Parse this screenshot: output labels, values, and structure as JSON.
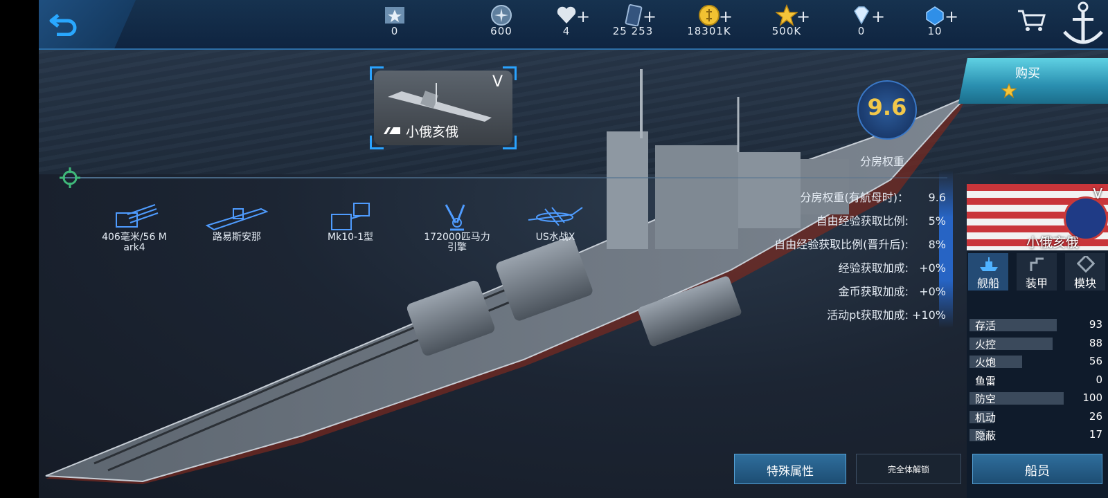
{
  "topbar": {
    "resources": [
      {
        "icon": "rank-badge-icon",
        "value": "0",
        "plus": ""
      },
      {
        "icon": "navy-emblem-icon",
        "value": "600",
        "plus": ""
      },
      {
        "icon": "heart-icon",
        "value": "4",
        "plus": "+"
      },
      {
        "icon": "card-icon",
        "value": "25 253",
        "plus": "+"
      },
      {
        "icon": "gold-coin-icon",
        "value": "18301K",
        "plus": "+"
      },
      {
        "icon": "star-icon",
        "value": "500K",
        "plus": "+"
      },
      {
        "icon": "diamond-icon",
        "value": "0",
        "plus": "+"
      },
      {
        "icon": "blue-gem-icon",
        "value": "10",
        "plus": "+"
      }
    ]
  },
  "ship_card": {
    "tier": "V",
    "name": "小俄亥俄"
  },
  "rating": {
    "value": "9.6",
    "label": "分房权重"
  },
  "buy": {
    "label": "购买"
  },
  "equipment": [
    {
      "icon": "main-gun-icon",
      "label_line1": "406毫米/56 M",
      "label_line2": "ark4"
    },
    {
      "icon": "hull-icon",
      "label_line1": "路易斯安那",
      "label_line2": ""
    },
    {
      "icon": "fire-control-icon",
      "label_line1": "Mk10-1型",
      "label_line2": ""
    },
    {
      "icon": "engine-icon",
      "label_line1": "172000匹马力",
      "label_line2": "引擎"
    },
    {
      "icon": "seaplane-icon",
      "label_line1": "US水战X",
      "label_line2": ""
    }
  ],
  "stats": [
    {
      "label": "分房权重(有航母时)：",
      "value": "9.6"
    },
    {
      "label": "自由经验获取比例:",
      "value": "5%"
    },
    {
      "label": "自由经验获取比例(晋升后):",
      "value": "8%"
    },
    {
      "label": "经验获取加成:",
      "value": "+0%"
    },
    {
      "label": "金币获取加成:",
      "value": "+0%"
    },
    {
      "label": "活动pt获取加成:",
      "value": "+10%"
    }
  ],
  "panel": {
    "tier": "V",
    "name": "小俄亥俄",
    "tabs": [
      {
        "label": "舰船",
        "icon": "ship-tab-icon",
        "active": true
      },
      {
        "label": "装甲",
        "icon": "armor-tab-icon",
        "active": false
      },
      {
        "label": "模块",
        "icon": "module-tab-icon",
        "active": false
      }
    ],
    "attributes": [
      {
        "name": "存活",
        "value": 93,
        "max": 100
      },
      {
        "name": "火控",
        "value": 88,
        "max": 100
      },
      {
        "name": "火炮",
        "value": 56,
        "max": 100
      },
      {
        "name": "鱼雷",
        "value": 0,
        "max": 100
      },
      {
        "name": "防空",
        "value": 100,
        "max": 100
      },
      {
        "name": "机动",
        "value": 26,
        "max": 100
      },
      {
        "name": "隐蔽",
        "value": 17,
        "max": 100
      }
    ],
    "crew_label": "船员"
  },
  "buttons": {
    "special": "特殊属性",
    "unlock": "完全体解锁"
  }
}
